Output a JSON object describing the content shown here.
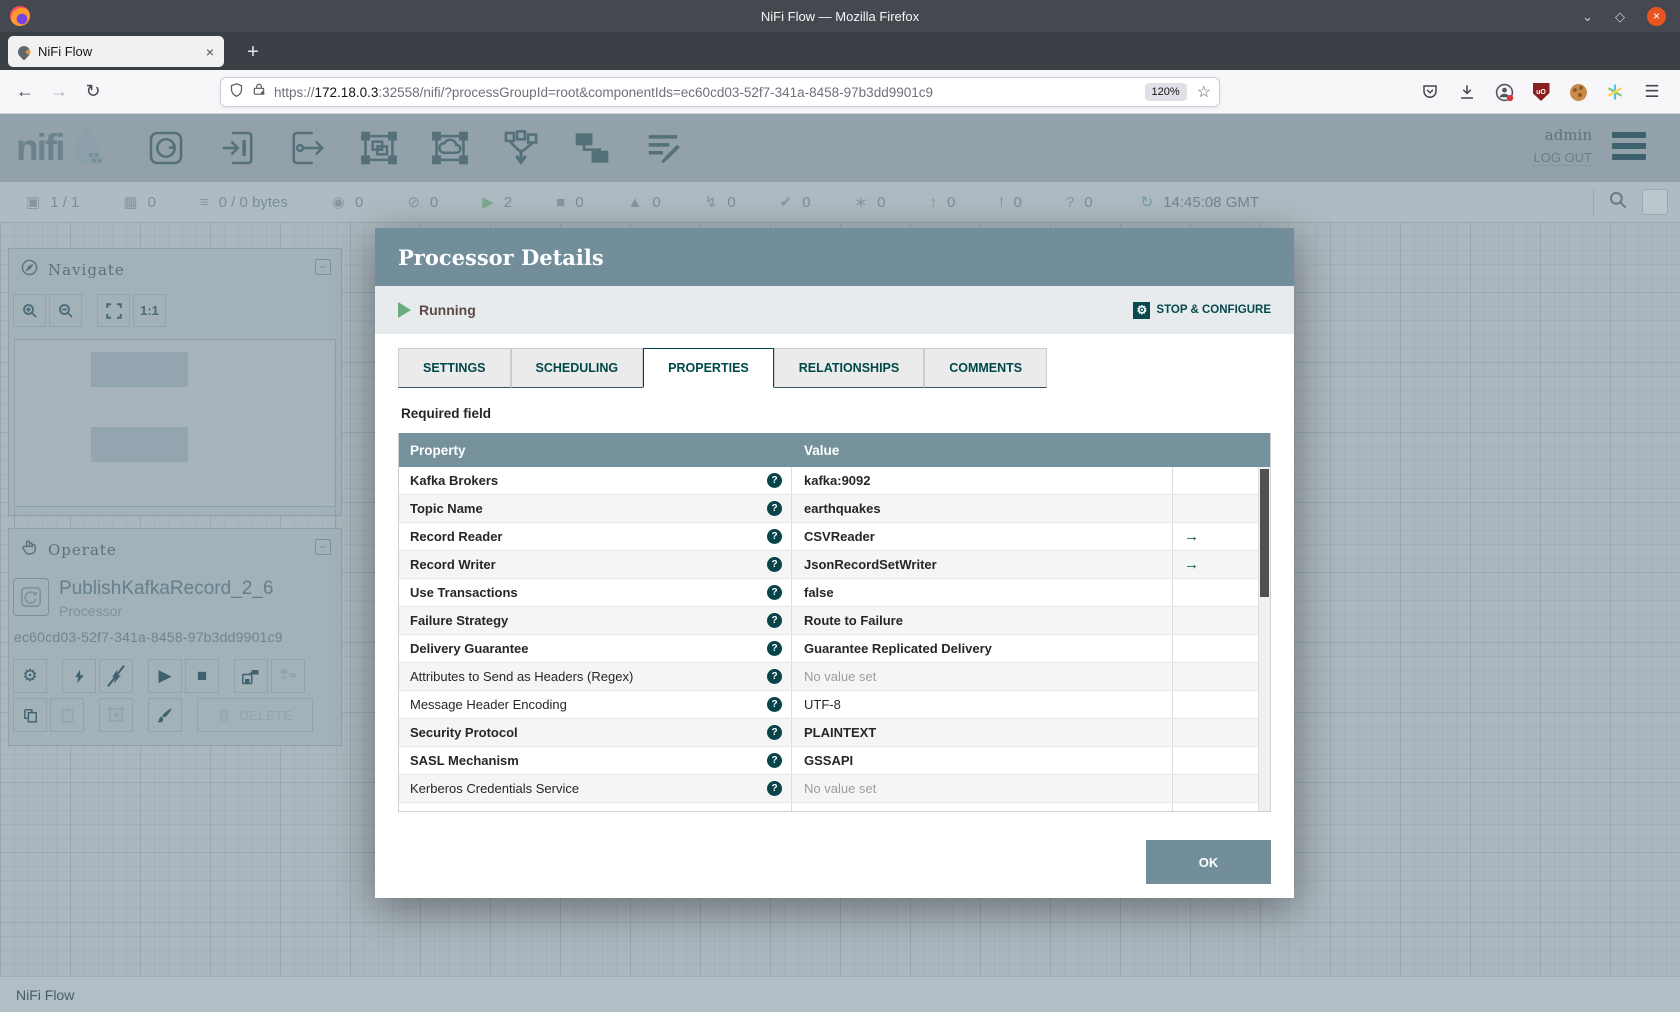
{
  "window": {
    "title": "NiFi Flow — Mozilla Firefox",
    "controls": [
      "minimize-chevron",
      "maximize-diamond",
      "close"
    ]
  },
  "browser": {
    "tab_title": "NiFi Flow",
    "tab_close": "×",
    "new_tab_label": "+",
    "back_glyph": "←",
    "forward_glyph": "→",
    "reload_glyph": "↻",
    "url_scheme": "https://",
    "url_host": "172.18.0.3",
    "url_rest": ":32558/nifi/?processGroupId=root&componentIds=ec60cd03-52f7-341a-8458-97b3dd9901c9",
    "zoom_level": "120%",
    "star_glyph": "☆",
    "extension_icons": [
      "pocket",
      "download",
      "account",
      "ublock",
      "cookie",
      "extension-sparkle",
      "menu"
    ],
    "ublock_label": "uO"
  },
  "nifi": {
    "logo_text": "nifi",
    "user": "admin",
    "logout_label": "LOG OUT",
    "toolbar_icons": [
      "processor",
      "input-port",
      "output-port",
      "process-group",
      "remote-process-group",
      "funnel",
      "template",
      "label"
    ],
    "status": {
      "items": [
        {
          "icon": "cluster",
          "value": "1 / 1"
        },
        {
          "icon": "threads",
          "value": "0"
        },
        {
          "icon": "queued",
          "value": "0 / 0 bytes"
        },
        {
          "icon": "transmitting",
          "value": "0"
        },
        {
          "icon": "not-transmitting",
          "value": "0"
        },
        {
          "icon": "running",
          "value": "2"
        },
        {
          "icon": "stopped",
          "value": "0"
        },
        {
          "icon": "invalid",
          "value": "0"
        },
        {
          "icon": "disabled",
          "value": "0"
        },
        {
          "icon": "up-to-date",
          "value": "0"
        },
        {
          "icon": "locally-modified",
          "value": "0"
        },
        {
          "icon": "stale",
          "value": "0"
        },
        {
          "icon": "locally-modified-stale",
          "value": "0"
        },
        {
          "icon": "sync-failure",
          "value": "0"
        }
      ],
      "refresh_time": "14:45:08 GMT"
    },
    "navigate": {
      "title": "Navigate",
      "one_to_one": "1:1"
    },
    "operate": {
      "title": "Operate",
      "component_name": "PublishKafkaRecord_2_6",
      "component_type": "Processor",
      "component_id": "ec60cd03-52f7-341a-8458-97b3dd9901c9",
      "delete_label": "DELETE"
    },
    "breadcrumb": "NiFi Flow"
  },
  "dialog": {
    "title": "Processor Details",
    "status_label": "Running",
    "stop_configure_label": "STOP & CONFIGURE",
    "tabs": [
      {
        "label": "SETTINGS",
        "active": false
      },
      {
        "label": "SCHEDULING",
        "active": false
      },
      {
        "label": "PROPERTIES",
        "active": true
      },
      {
        "label": "RELATIONSHIPS",
        "active": false
      },
      {
        "label": "COMMENTS",
        "active": false
      }
    ],
    "required_field_label": "Required field",
    "table": {
      "property_header": "Property",
      "value_header": "Value",
      "help_glyph": "?",
      "goto_glyph": "→",
      "rows": [
        {
          "property": "Kafka Brokers",
          "value": "kafka:9092",
          "required": true
        },
        {
          "property": "Topic Name",
          "value": "earthquakes",
          "required": true
        },
        {
          "property": "Record Reader",
          "value": "CSVReader",
          "required": true,
          "goto": true
        },
        {
          "property": "Record Writer",
          "value": "JsonRecordSetWriter",
          "required": true,
          "goto": true
        },
        {
          "property": "Use Transactions",
          "value": "false",
          "required": true
        },
        {
          "property": "Failure Strategy",
          "value": "Route to Failure",
          "required": true
        },
        {
          "property": "Delivery Guarantee",
          "value": "Guarantee Replicated Delivery",
          "required": true
        },
        {
          "property": "Attributes to Send as Headers (Regex)",
          "value": "No value set",
          "required": false,
          "empty": true
        },
        {
          "property": "Message Header Encoding",
          "value": "UTF-8",
          "required": false
        },
        {
          "property": "Security Protocol",
          "value": "PLAINTEXT",
          "required": true
        },
        {
          "property": "SASL Mechanism",
          "value": "GSSAPI",
          "required": true
        },
        {
          "property": "Kerberos Credentials Service",
          "value": "No value set",
          "required": false,
          "empty": true
        },
        {
          "property": "",
          "value": "",
          "required": false,
          "partial": true
        }
      ]
    },
    "ok_label": "OK"
  },
  "colors": {
    "accent": "#728E9B",
    "dark_teal": "#004849",
    "running_green": "#69AD7E",
    "close_button": "#E95420"
  }
}
